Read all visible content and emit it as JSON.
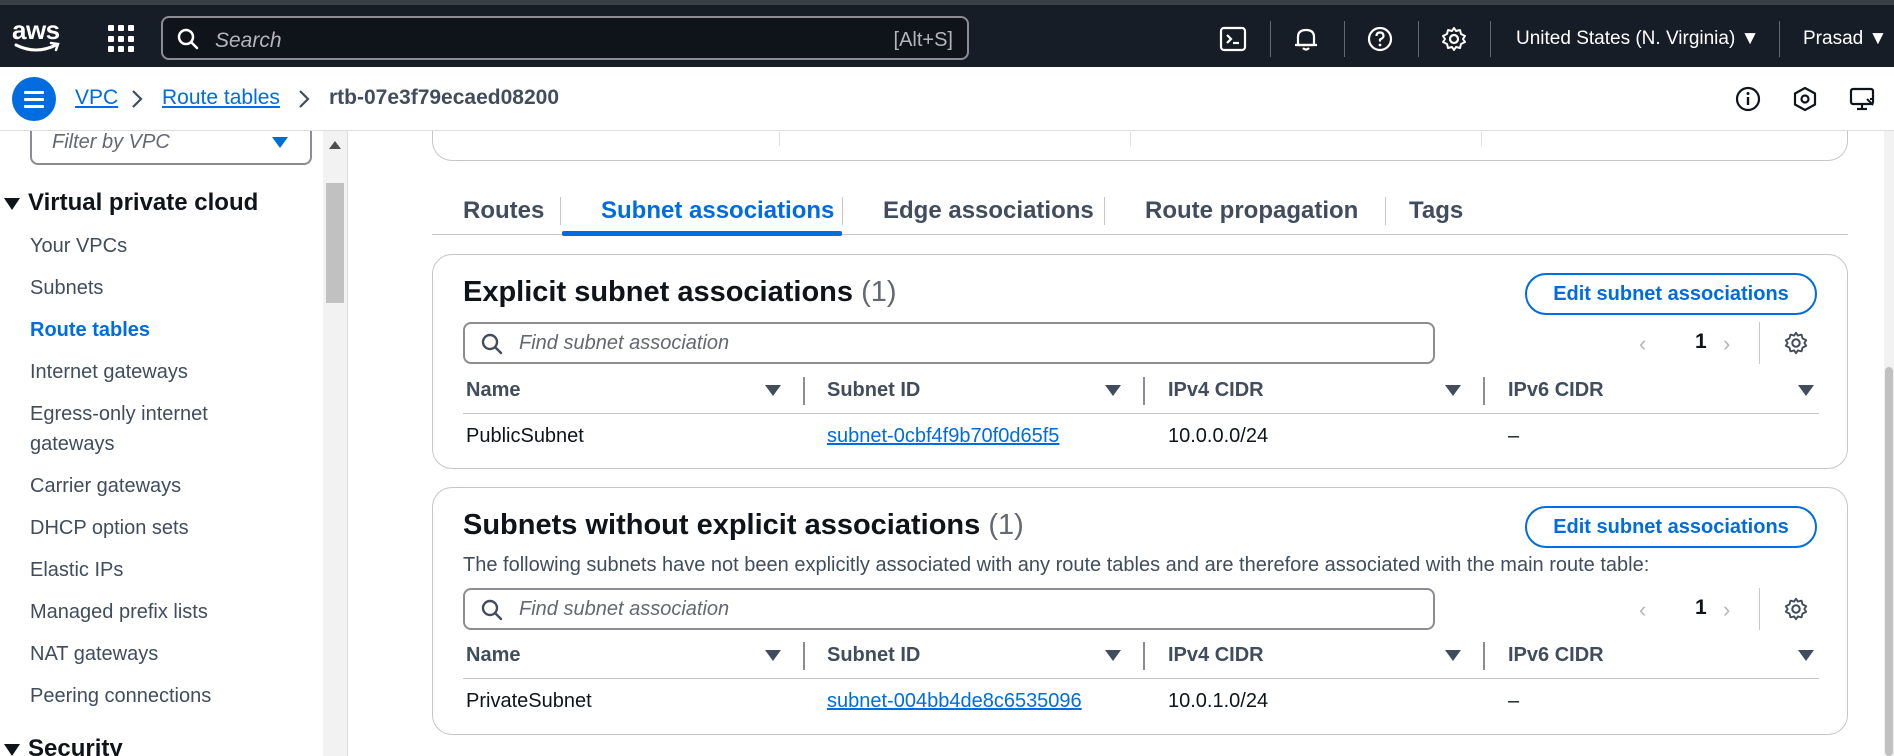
{
  "topnav": {
    "logo_text": "aws",
    "search_placeholder": "Search",
    "search_shortcut": "[Alt+S]",
    "region": "United States (N. Virginia) ▼",
    "user": "Prasad ▼"
  },
  "breadcrumb": {
    "items": [
      "VPC",
      "Route tables"
    ],
    "current": "rtb-07e3f79ecaed08200"
  },
  "sidebar": {
    "filter_placeholder": "Filter by VPC",
    "section_title": "Virtual private cloud",
    "items": [
      {
        "label": "Your VPCs"
      },
      {
        "label": "Subnets"
      },
      {
        "label": "Route tables",
        "active": true
      },
      {
        "label": "Internet gateways"
      },
      {
        "label": "Egress-only internet"
      },
      {
        "label": "gateways"
      },
      {
        "label": "Carrier gateways"
      },
      {
        "label": "DHCP option sets"
      },
      {
        "label": "Elastic IPs"
      },
      {
        "label": "Managed prefix lists"
      },
      {
        "label": "NAT gateways"
      },
      {
        "label": "Peering connections"
      }
    ],
    "next_section": "Security"
  },
  "tabs": [
    "Routes",
    "Subnet associations",
    "Edge associations",
    "Route propagation",
    "Tags"
  ],
  "active_tab": "Subnet associations",
  "explicit": {
    "title": "Explicit subnet associations",
    "count": "(1)",
    "edit_button": "Edit subnet associations",
    "find_placeholder": "Find subnet association",
    "page": "1",
    "columns": [
      "Name",
      "Subnet ID",
      "IPv4 CIDR",
      "IPv6 CIDR"
    ],
    "rows": [
      {
        "name": "PublicSubnet",
        "subnet_id": "subnet-0cbf4f9b70f0d65f5",
        "ipv4": "10.0.0.0/24",
        "ipv6": "–"
      }
    ]
  },
  "implicit": {
    "title": "Subnets without explicit associations",
    "count": "(1)",
    "description": "The following subnets have not been explicitly associated with any route tables and are therefore associated with the main route table:",
    "edit_button": "Edit subnet associations",
    "find_placeholder": "Find subnet association",
    "page": "1",
    "columns": [
      "Name",
      "Subnet ID",
      "IPv4 CIDR",
      "IPv6 CIDR"
    ],
    "rows": [
      {
        "name": "PrivateSubnet",
        "subnet_id": "subnet-004bb4de8c6535096",
        "ipv4": "10.0.1.0/24",
        "ipv6": "–"
      }
    ]
  },
  "colors": {
    "accent": "#006ce0",
    "topbar": "#161d26"
  }
}
